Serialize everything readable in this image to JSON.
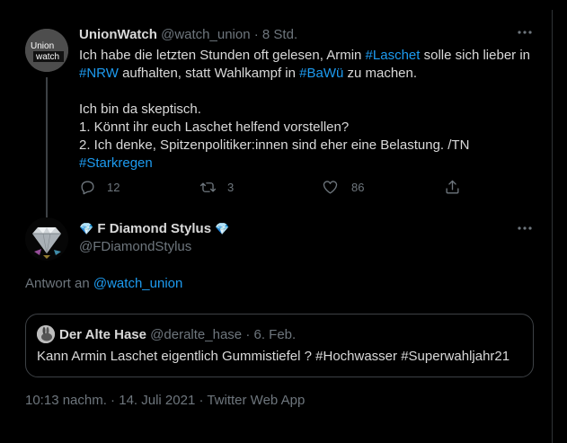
{
  "colors": {
    "background": "#000000",
    "text": "#d9d9d9",
    "muted": "#6e767d",
    "link": "#1d9bf0",
    "border": "#2f3336"
  },
  "parent_tweet": {
    "author_name": "UnionWatch",
    "author_handle": "@watch_union",
    "separator": "·",
    "time": "8 Std.",
    "avatar_text_line1": "Union",
    "avatar_text_line2": "watch",
    "more_icon": "more-horizontal-icon",
    "body": {
      "l1_a": "Ich habe die letzten Stunden oft gelesen, Armin ",
      "l1_tag": "#Laschet",
      "l1_b": " solle sich lieber in",
      "l2_tag1": "#NRW",
      "l2_a": " aufhalten, statt Wahlkampf in ",
      "l2_tag2": "#BaWü",
      "l2_b": " zu machen.",
      "l3": "Ich bin da skeptisch.",
      "l4": "1. Könnt ihr euch Laschet helfend vorstellen?",
      "l5": "2. Ich denke, Spitzenpolitiker:innen sind eher eine Belastung. /TN",
      "l6_tag": "#Starkregen"
    },
    "actions": {
      "reply_count": "12",
      "retweet_count": "3",
      "like_count": "86"
    }
  },
  "reply_tweet": {
    "emoji_left": "💎",
    "author_name": "F Diamond Stylus",
    "emoji_right": "💎",
    "author_handle": "@FDiamondStylus",
    "reply_prefix": "Antwort an ",
    "reply_target": "@watch_union",
    "quote": {
      "author_name": "Der Alte Hase",
      "author_handle": "@deralte_hase",
      "separator": "·",
      "date": "6. Feb.",
      "text": "Kann Armin Laschet eigentlich Gummistiefel ? #Hochwasser #Superwahljahr21"
    },
    "meta": "10:13 nachm. · 14. Juli 2021 · Twitter Web App"
  }
}
